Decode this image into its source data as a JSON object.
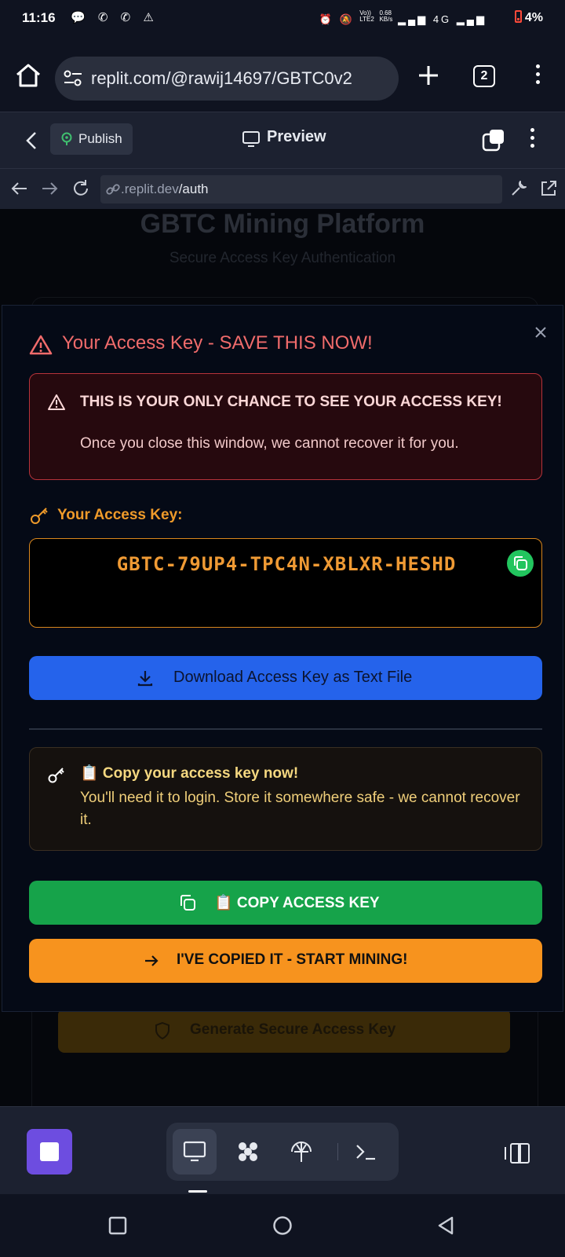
{
  "status_bar": {
    "time": "11:16",
    "network": "4G",
    "battery": "4%",
    "data_rate_value": "0.68",
    "data_rate_unit": "KB/s",
    "volte_line1": "Vo))",
    "volte_line2": "LTE2"
  },
  "browser": {
    "url": "replit.com/@rawij14697/GBTC0v2",
    "tab_count": "2"
  },
  "replit_header": {
    "publish_label": "Publish",
    "preview_label": "Preview"
  },
  "webview": {
    "domain": ".replit.dev",
    "path": "/auth"
  },
  "background_page": {
    "title": "GBTC Mining Platform",
    "subtitle": "Secure Access Key Authentication",
    "generate_button_label": "Generate Secure Access Key"
  },
  "modal": {
    "title": "Your Access Key - SAVE THIS NOW!",
    "warning_heading": "THIS IS YOUR ONLY CHANCE TO SEE YOUR ACCESS KEY!",
    "warning_text": "Once you close this window, we cannot recover it for you.",
    "key_label": "Your Access Key:",
    "access_key": "GBTC-79UP4-TPC4N-XBLXR-HESHD",
    "download_label": "Download Access Key as Text File",
    "note_heading": "📋 Copy your access key now!",
    "note_text": "You'll need it to login. Store it somewhere safe - we cannot recover it.",
    "copy_label": "📋 COPY ACCESS KEY",
    "start_label": "I'VE COPIED IT - START MINING!"
  },
  "colors": {
    "danger": "#f06b6b",
    "key_orange": "#ef9a34",
    "download_blue": "#2563eb",
    "copy_green": "#16a34a",
    "start_orange": "#f7931e",
    "stop_purple": "#6d4de0"
  }
}
